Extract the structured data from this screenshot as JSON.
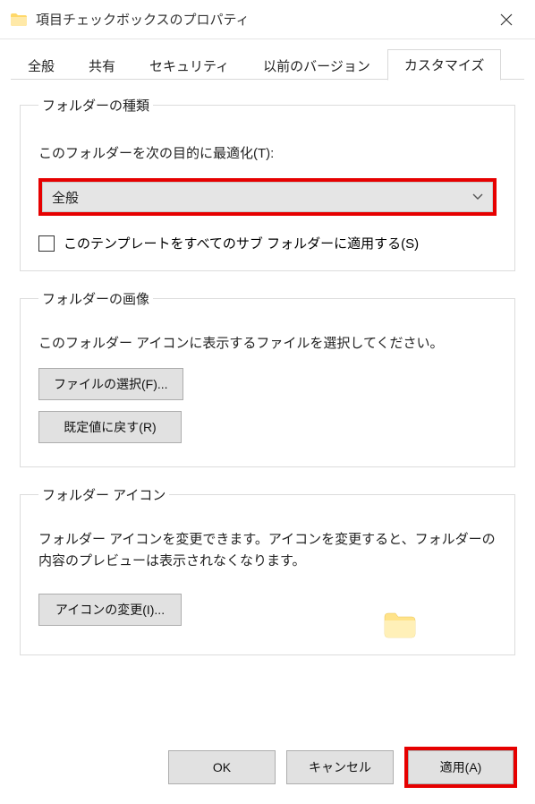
{
  "titlebar": {
    "title": "項目チェックボックスのプロパティ"
  },
  "tabs": [
    {
      "label": "全般"
    },
    {
      "label": "共有"
    },
    {
      "label": "セキュリティ"
    },
    {
      "label": "以前のバージョン"
    },
    {
      "label": "カスタマイズ"
    }
  ],
  "folder_type": {
    "legend": "フォルダーの種類",
    "optimize_label": "このフォルダーを次の目的に最適化(T):",
    "selected": "全般",
    "apply_sub_label": "このテンプレートをすべてのサブ フォルダーに適用する(S)"
  },
  "folder_image": {
    "legend": "フォルダーの画像",
    "desc": "このフォルダー アイコンに表示するファイルを選択してください。",
    "choose_file": "ファイルの選択(F)...",
    "reset_default": "既定値に戻す(R)"
  },
  "folder_icon": {
    "legend": "フォルダー アイコン",
    "desc": "フォルダー アイコンを変更できます。アイコンを変更すると、フォルダーの内容のプレビューは表示されなくなります。",
    "change_icon": "アイコンの変更(I)..."
  },
  "footer": {
    "ok": "OK",
    "cancel": "キャンセル",
    "apply": "適用(A)"
  }
}
